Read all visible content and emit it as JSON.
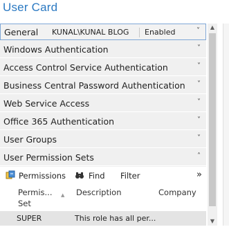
{
  "title": "User Card",
  "general": {
    "label": "General",
    "user": "KUNAL\\KUNAL BLOG",
    "state": "Enabled"
  },
  "sections": [
    {
      "label": "Windows Authentication",
      "chevron": "˅"
    },
    {
      "label": "Access Control Service Authentication",
      "chevron": "˅"
    },
    {
      "label": "Business Central Password Authentication",
      "chevron": "˅"
    },
    {
      "label": "Web Service Access",
      "chevron": "˅"
    },
    {
      "label": "Office 365 Authentication",
      "chevron": "˅"
    },
    {
      "label": "User Groups",
      "chevron": "˅"
    },
    {
      "label": "User Permission Sets",
      "chevron": "˄"
    }
  ],
  "toolbar": {
    "permissions": "Permissions",
    "find": "Find",
    "filter": "Filter",
    "more": "»"
  },
  "columns": {
    "set_line1": "Permis...",
    "set_line2": "Set",
    "description": "Description",
    "company": "Company",
    "sort": "▲"
  },
  "rows": [
    {
      "set": "SUPER",
      "description": "This role has all per..."
    }
  ],
  "scroll": {
    "up": "▲",
    "down": "▼"
  }
}
